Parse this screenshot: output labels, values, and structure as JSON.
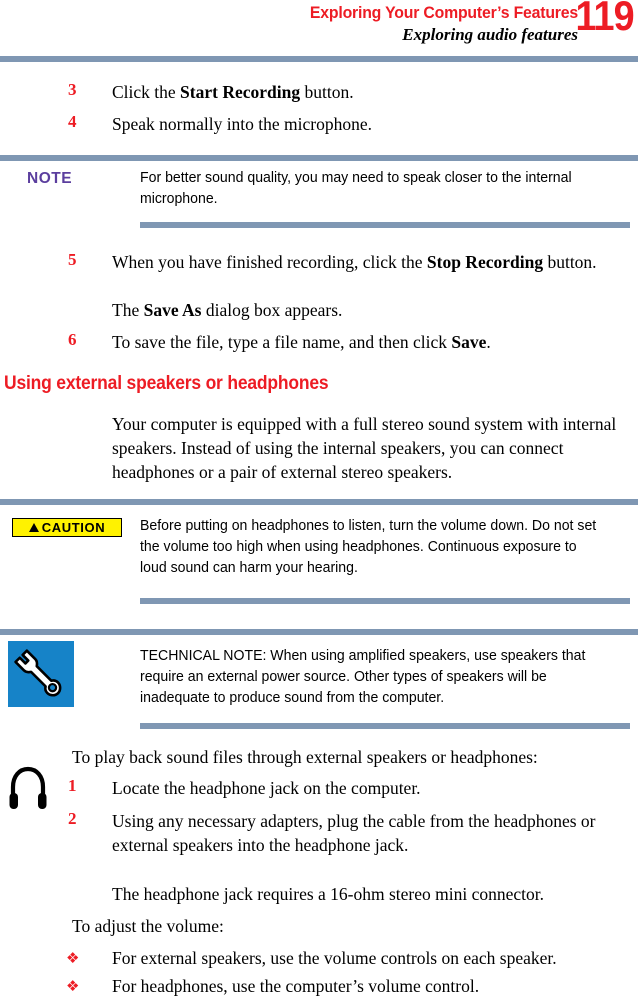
{
  "header": {
    "chapter_title": "Exploring Your Computer’s Features",
    "section_title": "Exploring audio features",
    "page_number": "119",
    "accent_color": "#ED1C24",
    "rule_color": "#7F97B3"
  },
  "steps_recording": [
    {
      "number": "3",
      "text_before": "Click the ",
      "bold": "Start Recording",
      "text_after": " button."
    },
    {
      "number": "4",
      "text_before": "Speak normally into the microphone.",
      "bold": "",
      "text_after": ""
    }
  ],
  "note_callout": {
    "label": "NOTE",
    "label_color": "#5B3E9E",
    "text": "For better sound quality, you may need to speak closer to the internal microphone."
  },
  "steps_recording_cont": [
    {
      "number": "5",
      "text_before": "When you have finished recording, click the ",
      "bold": "Stop Recording",
      "text_after": " button."
    },
    {
      "number": "6",
      "text_before": "To save the file, type a file name, and then click ",
      "bold": "Save",
      "text_after": "."
    }
  ],
  "save_as_para": {
    "text_before": "The ",
    "bold": "Save As",
    "text_after": " dialog box appears."
  },
  "section": {
    "heading": "Using external speakers or headphones",
    "paragraph": "Your computer is equipped with a full stereo sound system with internal speakers. Instead of using the internal speakers, you can connect headphones or a pair of external stereo speakers."
  },
  "caution_callout": {
    "label": "CAUTION",
    "badge_bg": "#FFF200",
    "icon": "warning-triangle-icon",
    "text": "Before putting on headphones to listen, turn the volume down. Do not set the volume too high when using headphones. Continuous exposure to loud sound can harm your hearing."
  },
  "technical_note_callout": {
    "icon": "wrench-icon",
    "icon_bg": "#1683C8",
    "text": "TECHNICAL NOTE: When using amplified speakers, use speakers that require an external power source. Other types of speakers will be inadequate to produce sound from the computer."
  },
  "playback": {
    "intro": "To play back sound files through external speakers or headphones:",
    "margin_icon": "headphones-icon",
    "steps": [
      {
        "number": "1",
        "text": "Locate the headphone jack on the computer."
      },
      {
        "number": "2",
        "text": "Using any necessary adapters, plug the cable from the headphones or external speakers into the headphone jack."
      }
    ],
    "result": "The headphone jack requires a 16-ohm stereo mini connector."
  },
  "volume": {
    "intro": "To adjust the volume:",
    "bullet_glyph": "❖",
    "bullets": [
      "For external speakers, use the volume controls on each speaker.",
      "For headphones, use the computer’s volume control."
    ]
  }
}
